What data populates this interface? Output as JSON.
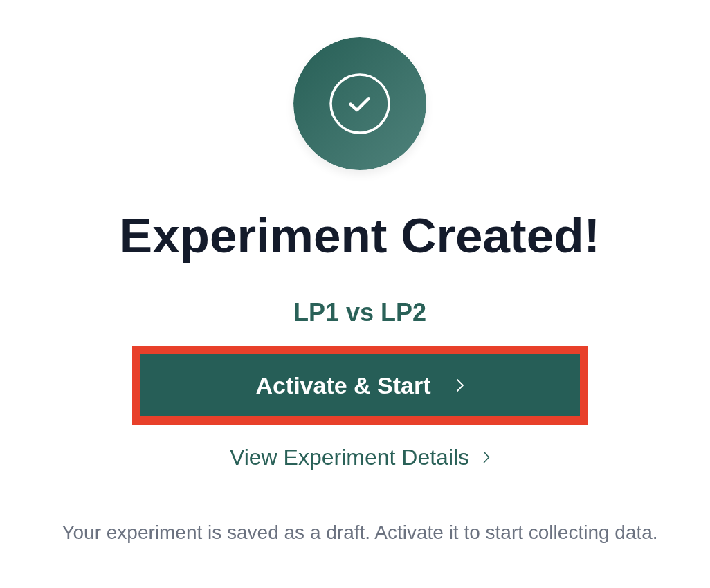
{
  "title": "Experiment Created!",
  "subtitle": "LP1 vs LP2",
  "primary_button": {
    "label": "Activate & Start",
    "highlighted": true
  },
  "details_link": {
    "label": "View Experiment Details"
  },
  "note": "Your experiment is saved as a draft. Activate it to start collecting data."
}
